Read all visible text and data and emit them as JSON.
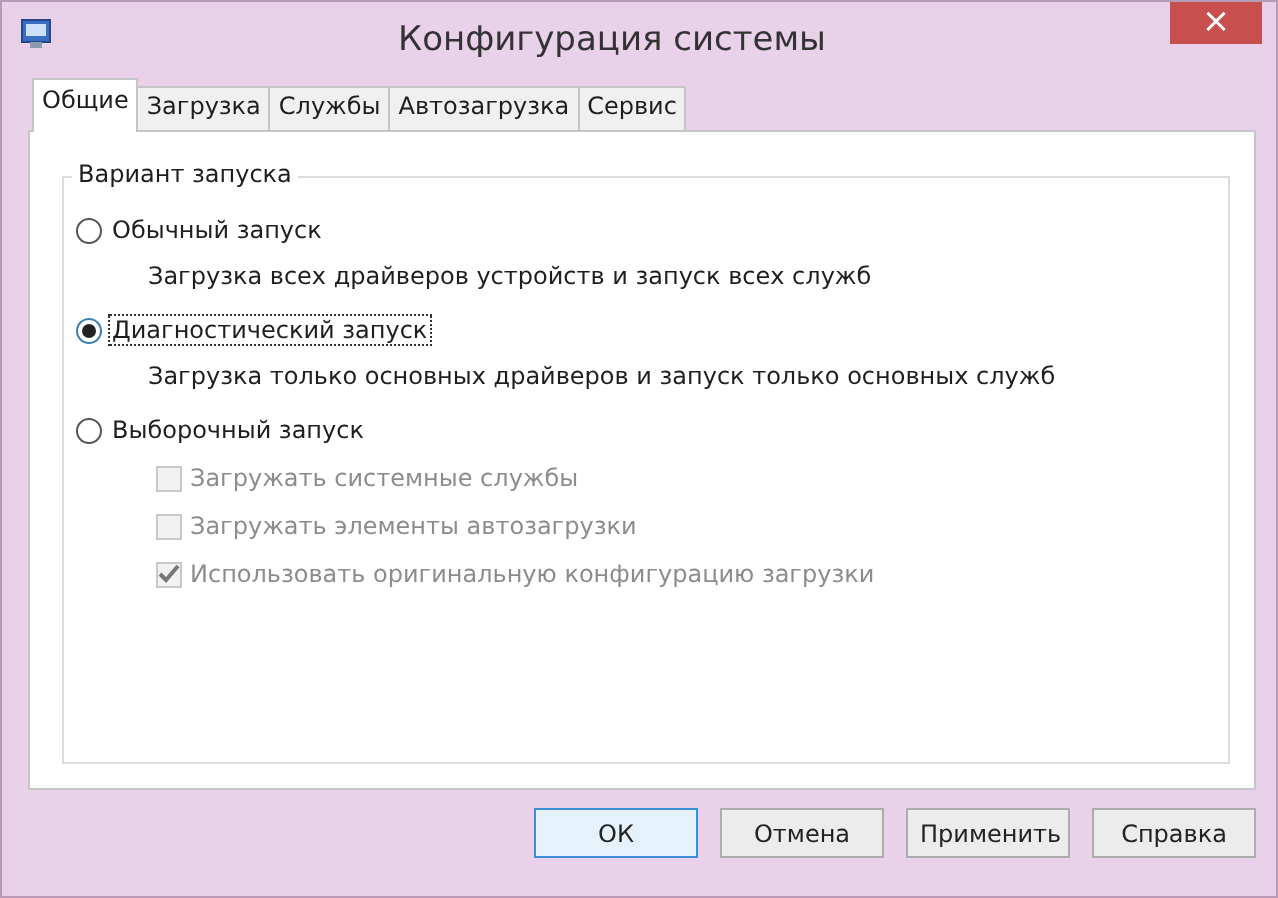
{
  "window": {
    "title": "Конфигурация системы",
    "close": "×"
  },
  "tabs": [
    {
      "label": "Общие",
      "selected": true
    },
    {
      "label": "Загрузка",
      "selected": false
    },
    {
      "label": "Службы",
      "selected": false
    },
    {
      "label": "Автозагрузка",
      "selected": false
    },
    {
      "label": "Сервис",
      "selected": false
    }
  ],
  "group": {
    "title": "Вариант запуска",
    "options": [
      {
        "kind": "radio",
        "label": "Обычный запуск",
        "selected": false,
        "description": "Загрузка всех драйверов устройств и запуск всех служб"
      },
      {
        "kind": "radio",
        "label": "Диагностический запуск",
        "selected": true,
        "description": "Загрузка только основных драйверов и запуск только основных служб"
      },
      {
        "kind": "radio",
        "label": "Выборочный запуск",
        "selected": false
      },
      {
        "kind": "checkbox",
        "label": "Загружать системные службы",
        "checked": false,
        "disabled": true
      },
      {
        "kind": "checkbox",
        "label": "Загружать элементы автозагрузки",
        "checked": false,
        "disabled": true
      },
      {
        "kind": "checkbox",
        "label": "Использовать оригинальную конфигурацию загрузки",
        "checked": true,
        "disabled": true
      }
    ]
  },
  "buttons": [
    {
      "label": "ОК",
      "default": true
    },
    {
      "label": "Отмена",
      "default": false
    },
    {
      "label": "Применить",
      "default": false
    },
    {
      "label": "Справка",
      "default": false
    }
  ]
}
